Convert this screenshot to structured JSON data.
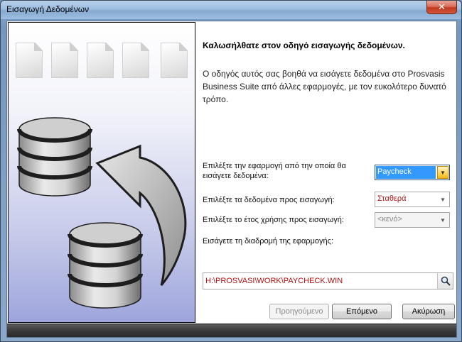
{
  "window": {
    "title": "Εισαγωγή Δεδομένων"
  },
  "wizard": {
    "heading": "Καλωσήλθατε στον οδηγό εισαγωγής δεδομένων.",
    "intro": "Ο οδηγός αυτός σας βοηθά να εισάγετε δεδομένα στο Prosvasis Business Suite από άλλες εφαρμογές, με τον ευκολότερο δυνατό τρόπο.",
    "app_label": "Επιλέξτε την εφαρμογή από την οποία θα εισάγετε δεδομένα:",
    "app_value": "Paycheck",
    "data_label": "Επιλέξτε τα δεδομένα προς εισαγωγή:",
    "data_value": "Σταθερά",
    "year_label": "Επιλέξτε το έτος χρήσης προς εισαγωγή:",
    "year_value": "<κενό>",
    "path_label": "Εισάγετε τη διαδρομή της εφαρμογής:",
    "path_value": "H:\\PROSVASI\\WORK\\PAYCHECK.WIN"
  },
  "buttons": {
    "prev": "Προηγούμενο",
    "next": "Επόμενο",
    "cancel": "Ακύρωση"
  },
  "colors": {
    "accent": "#3399ff",
    "error_text": "#b31212"
  }
}
